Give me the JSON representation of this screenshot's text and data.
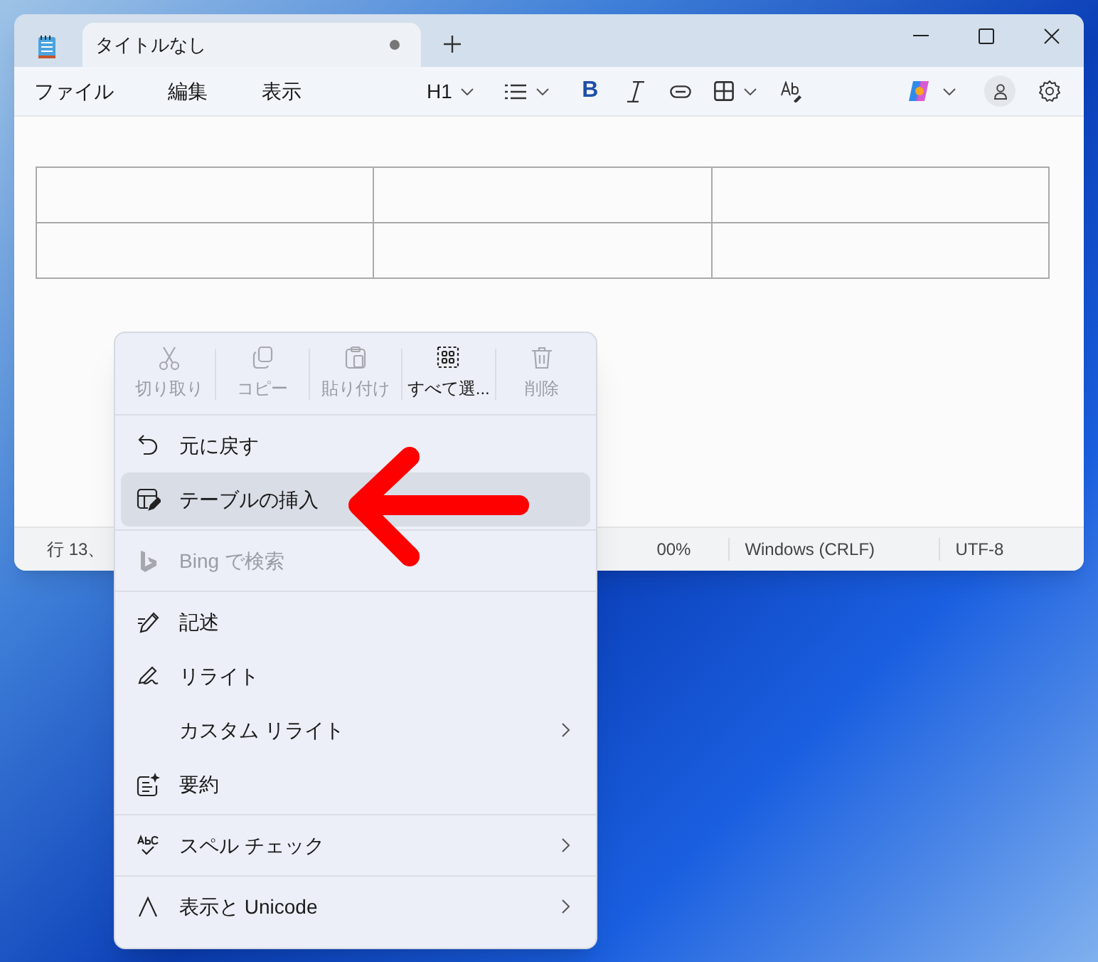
{
  "window": {
    "tab": {
      "title": "タイトルなし",
      "modified": true,
      "selected": true
    }
  },
  "menu_bar": [
    "ファイル",
    "編集",
    "表示"
  ],
  "toolbar": {
    "heading": "H1",
    "bold": "B"
  },
  "status_bar": {
    "position": "行 13、",
    "zoom": "00%",
    "line_ending": "Windows (CRLF)",
    "encoding": "UTF-8"
  },
  "context_menu": {
    "actions": [
      {
        "label": "切り取り",
        "disabled": true
      },
      {
        "label": "コピー",
        "disabled": true
      },
      {
        "label": "貼り付け",
        "disabled": true
      },
      {
        "label": "すべて選...",
        "disabled": false
      },
      {
        "label": "削除",
        "disabled": true
      }
    ],
    "groups": [
      [
        {
          "label": "元に戻す",
          "disabled": false,
          "highlighted": false,
          "submenu": false
        },
        {
          "label": "テーブルの挿入",
          "disabled": false,
          "highlighted": true,
          "submenu": false
        }
      ],
      [
        {
          "label": "Bing で検索",
          "disabled": true,
          "highlighted": false,
          "submenu": false
        }
      ],
      [
        {
          "label": "記述",
          "disabled": false,
          "highlighted": false,
          "submenu": false
        },
        {
          "label": "リライト",
          "disabled": false,
          "highlighted": false,
          "submenu": false
        },
        {
          "label": "カスタム リライト",
          "disabled": false,
          "highlighted": false,
          "submenu": true
        },
        {
          "label": "要約",
          "disabled": false,
          "highlighted": false,
          "submenu": false
        }
      ],
      [
        {
          "label": "スペル チェック",
          "disabled": false,
          "highlighted": false,
          "submenu": true
        }
      ],
      [
        {
          "label": "表示と Unicode",
          "disabled": false,
          "highlighted": false,
          "submenu": true
        }
      ]
    ]
  }
}
